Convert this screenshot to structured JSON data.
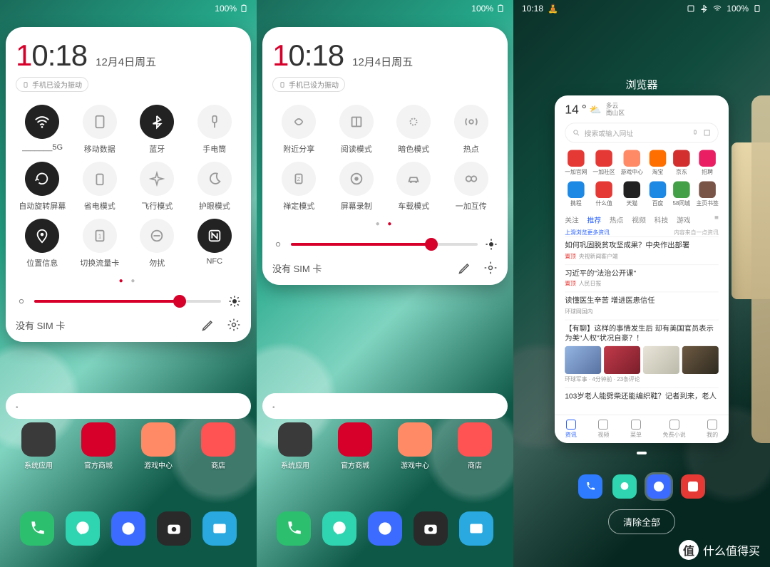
{
  "status": {
    "time": "10:18",
    "battery": "100%"
  },
  "panel": {
    "clock_h1": "1",
    "clock_rest": "0:18",
    "date": "12月4日周五",
    "vibration": "手机已设为振动",
    "sim": "没有 SIM 卡",
    "slider1_pct": 78,
    "slider2_pct": 75,
    "page_dots": 2,
    "page_active": 0
  },
  "tiles_p1": [
    {
      "label": "_______5G",
      "on": true,
      "icon": "wifi"
    },
    {
      "label": "移动数据",
      "on": false,
      "icon": "sim"
    },
    {
      "label": "蓝牙",
      "on": true,
      "icon": "bluetooth"
    },
    {
      "label": "手电筒",
      "on": false,
      "icon": "flash"
    },
    {
      "label": "自动旋转屏幕",
      "on": true,
      "icon": "rotate"
    },
    {
      "label": "省电模式",
      "on": false,
      "icon": "battery"
    },
    {
      "label": "飞行模式",
      "on": false,
      "icon": "plane"
    },
    {
      "label": "护眼模式",
      "on": false,
      "icon": "moon"
    },
    {
      "label": "位置信息",
      "on": true,
      "icon": "location"
    },
    {
      "label": "切换流量卡",
      "on": false,
      "icon": "simswap"
    },
    {
      "label": "勿扰",
      "on": false,
      "icon": "dnd"
    },
    {
      "label": "NFC",
      "on": true,
      "icon": "nfc"
    }
  ],
  "tiles_p2": [
    {
      "label": "附近分享",
      "on": false,
      "icon": "share"
    },
    {
      "label": "阅读模式",
      "on": false,
      "icon": "book"
    },
    {
      "label": "暗色模式",
      "on": false,
      "icon": "dark"
    },
    {
      "label": "热点",
      "on": false,
      "icon": "hotspot"
    },
    {
      "label": "禅定模式",
      "on": false,
      "icon": "zen"
    },
    {
      "label": "屏幕录制",
      "on": false,
      "icon": "record"
    },
    {
      "label": "车载模式",
      "on": false,
      "icon": "car"
    },
    {
      "label": "一加互传",
      "on": false,
      "icon": "beam"
    }
  ],
  "home_apps": [
    {
      "label": "系统应用",
      "color": "#3a3a3a"
    },
    {
      "label": "官方商城",
      "color": "#d6002a"
    },
    {
      "label": "游戏中心",
      "color": "#ff8a65"
    },
    {
      "label": "商店",
      "color": "#ff5252"
    }
  ],
  "dock": [
    {
      "name": "phone",
      "color": "#2cbf6e"
    },
    {
      "name": "messages",
      "color": "#2fd5b0"
    },
    {
      "name": "browser",
      "color": "#3b6cff"
    },
    {
      "name": "camera",
      "color": "#2a2a2a"
    },
    {
      "name": "gallery",
      "color": "#2aa8e0"
    }
  ],
  "recents": {
    "title": "浏览器",
    "clear": "清除全部",
    "weather_temp": "14",
    "weather_unit": "°",
    "weather_cond": "多云",
    "weather_loc": "南山区",
    "search_placeholder": "搜索或输入网址",
    "grid": [
      {
        "n": "一加官网",
        "c": "#e53935"
      },
      {
        "n": "一加社区",
        "c": "#e53935"
      },
      {
        "n": "游戏中心",
        "c": "#ff8a65"
      },
      {
        "n": "淘宝",
        "c": "#ff6f00"
      },
      {
        "n": "京东",
        "c": "#d32f2f"
      },
      {
        "n": "招聘",
        "c": "#e91e63"
      },
      {
        "n": "携程",
        "c": "#1e88e5"
      },
      {
        "n": "什么值",
        "c": "#e53935"
      },
      {
        "n": "天猫",
        "c": "#212121"
      },
      {
        "n": "百度",
        "c": "#1e88e5"
      },
      {
        "n": "58同城",
        "c": "#43a047"
      },
      {
        "n": "主页书签",
        "c": "#795548"
      }
    ],
    "tabs": [
      "关注",
      "推荐",
      "热点",
      "视频",
      "科技",
      "游戏"
    ],
    "tab_active": 1,
    "feed_head_l": "上滑浏览更多资讯",
    "feed_head_r": "内容来自一点资讯",
    "news": [
      {
        "t": "如何巩固脱贫攻坚成果？中央作出部署",
        "s": "央视新闻客户端",
        "top": true
      },
      {
        "t": "习近平的\"法治公开课\"",
        "s": "人民日报",
        "top": true
      },
      {
        "t": "读懂医生辛苦 增进医患信任",
        "s": "环球网国内",
        "top": false
      },
      {
        "t": "【有聊】这样的事情发生后 却有美国官员表示为美\"人权\"状况自豪？！",
        "s": "环球军事 · 4分钟前 · 23条评论",
        "top": false,
        "imgs": true
      },
      {
        "t": "103岁老人能劈柴还能编织鞋？记者到来，老人",
        "s": "",
        "top": false
      }
    ],
    "bottom": [
      {
        "n": "资讯",
        "on": true
      },
      {
        "n": "视频"
      },
      {
        "n": "菜单"
      },
      {
        "n": "免费小说"
      },
      {
        "n": "我的"
      }
    ]
  },
  "watermark": "什么值得买"
}
